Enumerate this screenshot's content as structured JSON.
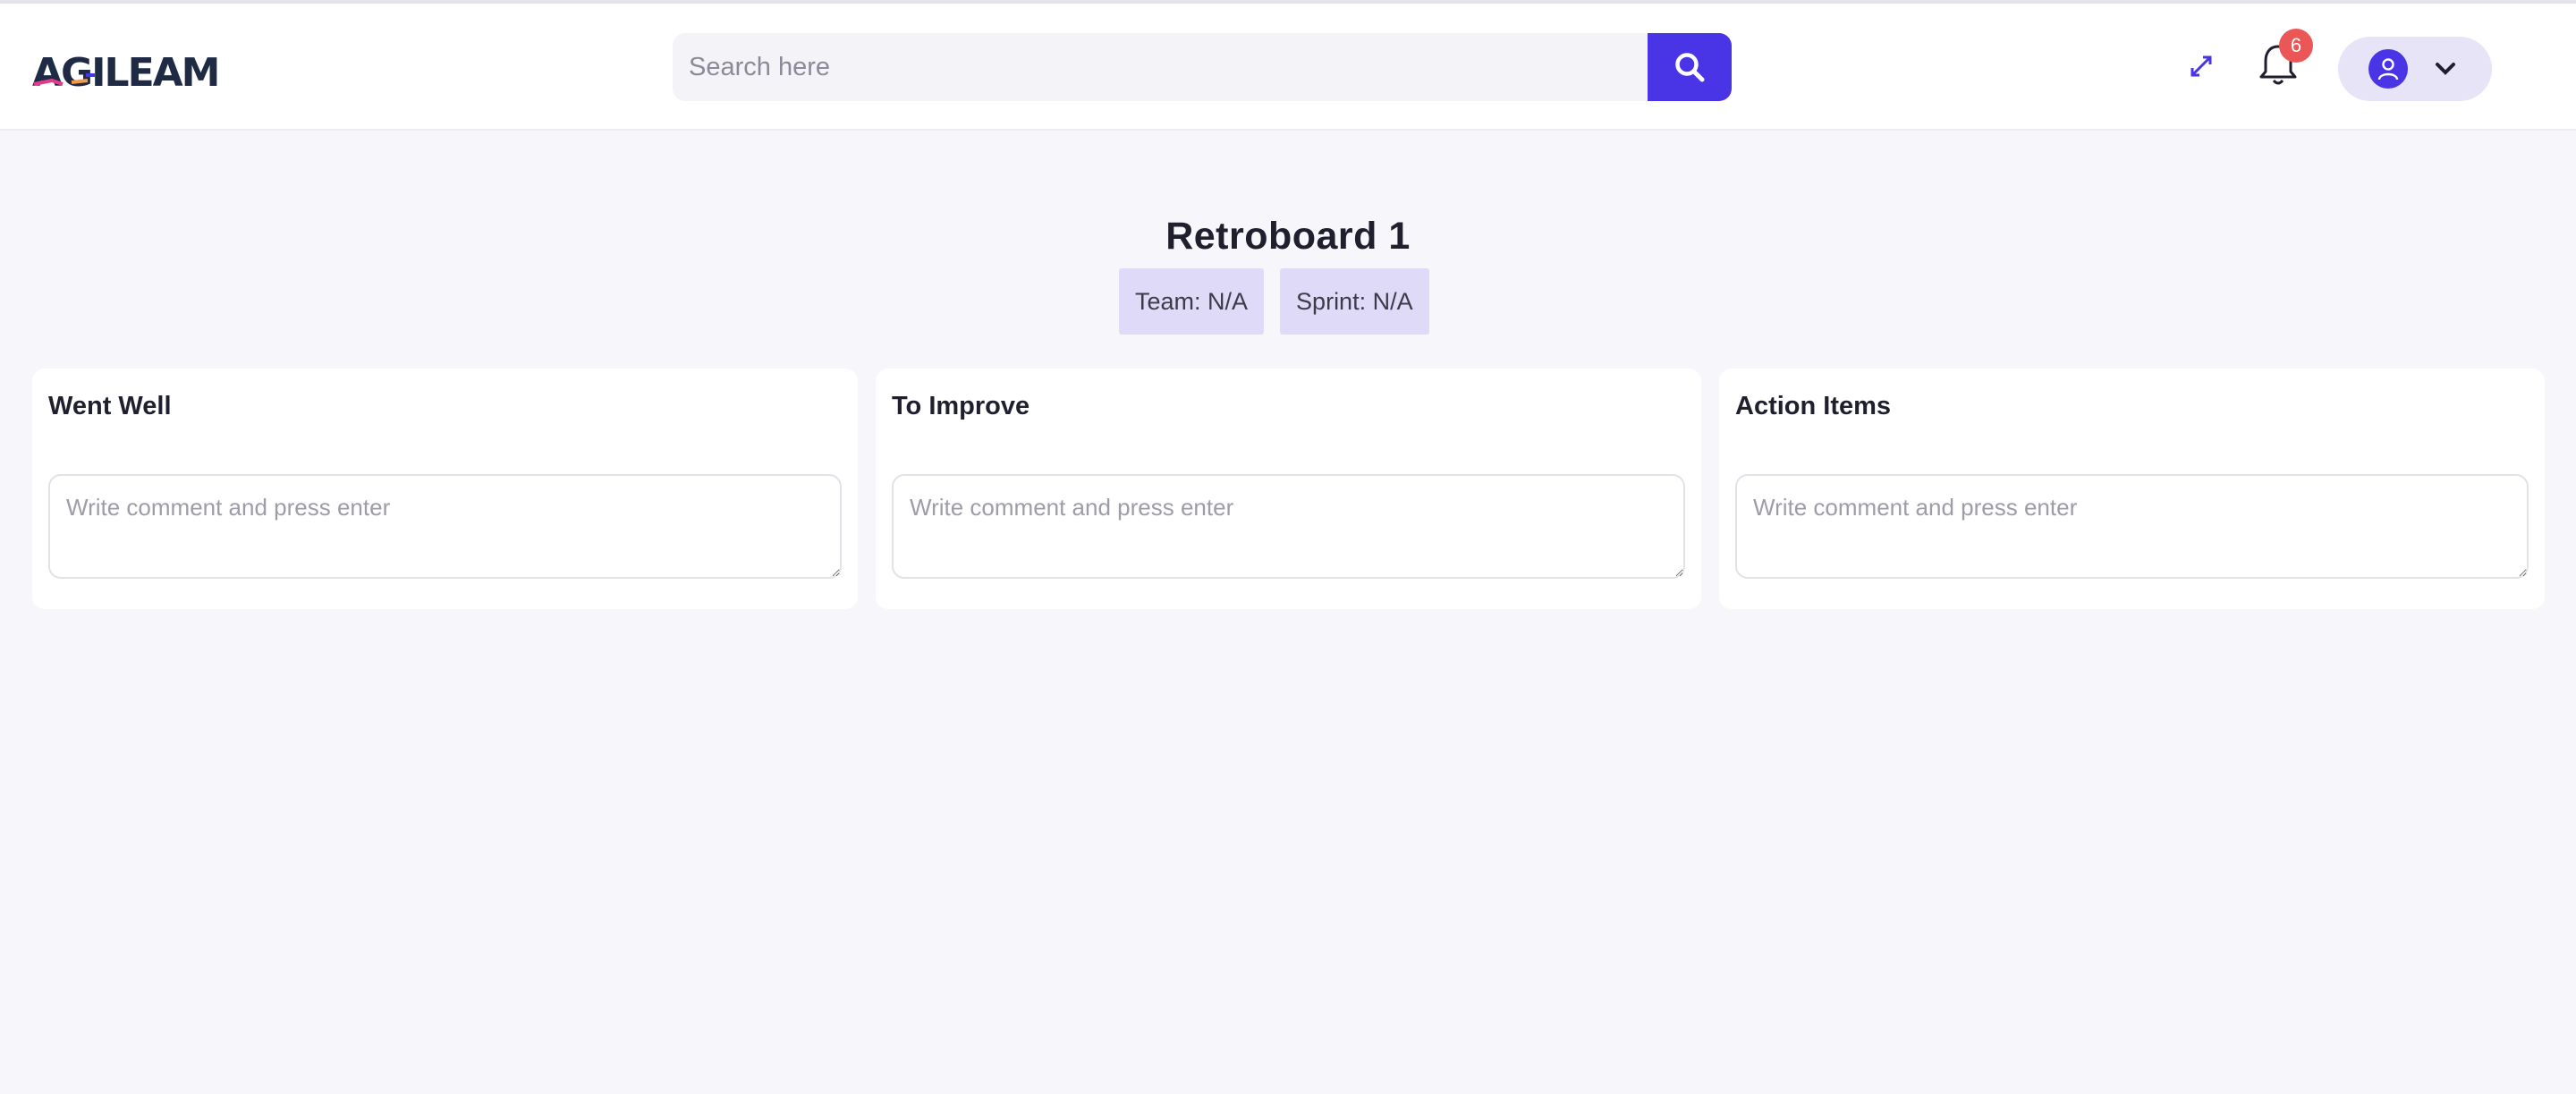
{
  "header": {
    "logo_text": "AGILEAM",
    "search": {
      "placeholder": "Search here",
      "value": ""
    },
    "notifications": {
      "count": "6"
    }
  },
  "board": {
    "title": "Retroboard 1",
    "team_tag": "Team: N/A",
    "sprint_tag": "Sprint: N/A"
  },
  "columns": [
    {
      "title": "Went Well",
      "placeholder": "Write comment and press enter"
    },
    {
      "title": "To Improve",
      "placeholder": "Write comment and press enter"
    },
    {
      "title": "Action Items",
      "placeholder": "Write comment and press enter"
    }
  ],
  "colors": {
    "accent": "#4a35e6",
    "badge": "#eb5757",
    "tag_bg": "#dedaf8",
    "page_bg": "#f7f6fb"
  },
  "icons": [
    "search-icon",
    "expand-icon",
    "bell-icon",
    "user-icon",
    "chevron-down-icon"
  ]
}
